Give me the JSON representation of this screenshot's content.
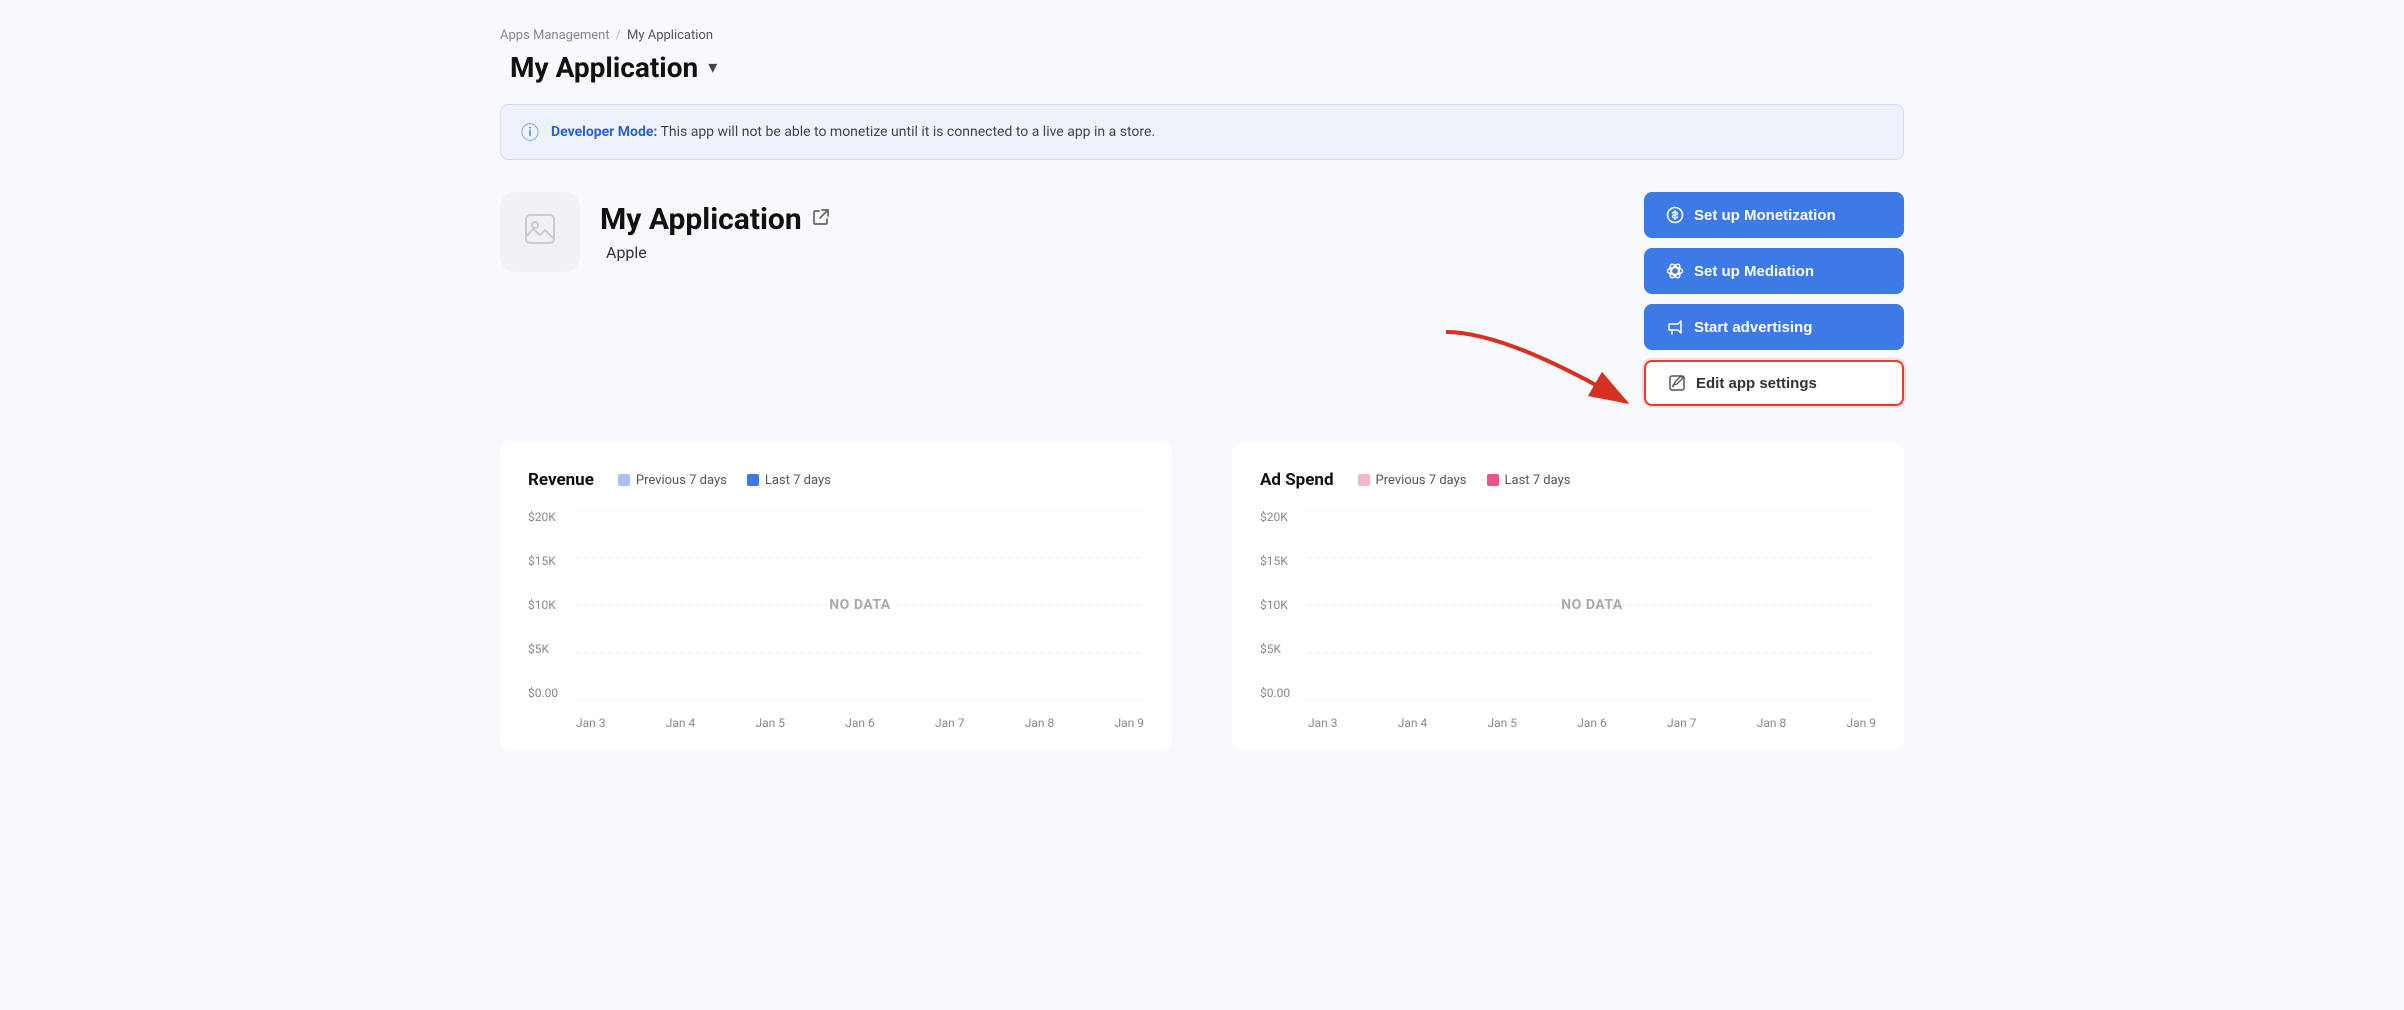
{
  "breadcrumb": {
    "parent": "Apps Management",
    "separator": "/",
    "current": "My Application"
  },
  "page_title": {
    "label": "My Application",
    "chevron": "▾",
    "apple_icon": ""
  },
  "developer_banner": {
    "text_bold": "Developer Mode:",
    "text_rest": " This app will not be able to monetize until it is connected to a live app in a store."
  },
  "app_info": {
    "title": "My Application",
    "platform": "Apple",
    "external_link_title": "Open external link"
  },
  "action_buttons": {
    "monetization": "Set up Monetization",
    "mediation": "Set up Mediation",
    "advertising": "Start advertising",
    "edit_settings": "Edit app settings"
  },
  "revenue_chart": {
    "title": "Revenue",
    "legend_prev": "Previous 7 days",
    "legend_last": "Last 7 days",
    "prev_color": "#a8c4f0",
    "last_color": "#3d7ae5",
    "no_data": "NO DATA",
    "y_labels": [
      "$20K",
      "$15K",
      "$10K",
      "$5K",
      "$0.00"
    ],
    "x_labels": [
      "Jan 3",
      "Jan 4",
      "Jan 5",
      "Jan 6",
      "Jan 7",
      "Jan 8",
      "Jan 9"
    ]
  },
  "adspend_chart": {
    "title": "Ad Spend",
    "legend_prev": "Previous 7 days",
    "legend_last": "Last 7 days",
    "prev_color": "#f0b8c8",
    "last_color": "#e8558a",
    "no_data": "NO DATA",
    "y_labels": [
      "$20K",
      "$15K",
      "$10K",
      "$5K",
      "$0.00"
    ],
    "x_labels": [
      "Jan 3",
      "Jan 4",
      "Jan 5",
      "Jan 6",
      "Jan 7",
      "Jan 8",
      "Jan 9"
    ]
  },
  "icons": {
    "dollar": "$",
    "layers": "⊕",
    "megaphone": "📣",
    "edit": "✎",
    "info": "ⓘ",
    "image_placeholder": "🖼"
  }
}
